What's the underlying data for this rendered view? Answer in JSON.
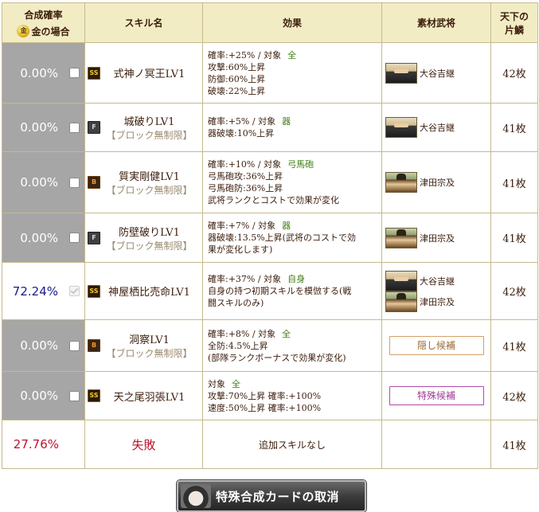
{
  "header": {
    "rate_title": "合成確率",
    "rate_sub": "金の場合",
    "coin_icon_text": "金",
    "skill": "スキル名",
    "effect": "効果",
    "material": "素材武将",
    "shard_line1": "天下の",
    "shard_line2": "片鱗"
  },
  "rows": [
    {
      "rate": "0.00%",
      "enabled": false,
      "checked": false,
      "rank": "SS",
      "name": "式神ノ冥王LV1",
      "sub": "",
      "effect_l1": "確率:+25% / 対象",
      "target": "全",
      "effect_rest": [
        "攻撃:60%上昇",
        "防御:60%上昇",
        "破壊:22%上昇"
      ],
      "materials": [
        {
          "name": "大谷吉継"
        }
      ],
      "tag": "",
      "count": "42枚"
    },
    {
      "rate": "0.00%",
      "enabled": false,
      "checked": false,
      "rank": "F",
      "name": "城破りLV1",
      "sub": "【ブロック無制限】",
      "effect_l1": "確率:+5% / 対象",
      "target": "器",
      "effect_rest": [
        "器破壊:10%上昇"
      ],
      "materials": [
        {
          "name": "大谷吉継"
        }
      ],
      "tag": "",
      "count": "41枚"
    },
    {
      "rate": "0.00%",
      "enabled": false,
      "checked": false,
      "rank": "B",
      "name": "質実剛健LV1",
      "sub": "【ブロック無制限】",
      "effect_l1": "確率:+10% / 対象",
      "target": "弓馬砲",
      "effect_rest": [
        "弓馬砲攻:36%上昇",
        "弓馬砲防:36%上昇",
        "武将ランクとコストで効果が変化"
      ],
      "materials": [
        {
          "name": "津田宗及"
        }
      ],
      "tag": "",
      "count": "41枚"
    },
    {
      "rate": "0.00%",
      "enabled": false,
      "checked": false,
      "rank": "F",
      "name": "防壁破りLV1",
      "sub": "【ブロック無制限】",
      "effect_l1": "確率:+7% / 対象",
      "target": "器",
      "effect_rest": [
        "器破壊:13.5%上昇(武将のコストで効",
        "果が変化します)"
      ],
      "materials": [
        {
          "name": "津田宗及"
        }
      ],
      "tag": "",
      "count": "41枚"
    },
    {
      "rate": "72.24%",
      "enabled": true,
      "checked": true,
      "rank": "SS",
      "name": "神屋栖比売命LV1",
      "sub": "",
      "effect_l1": "確率:+37% / 対象",
      "target": "自身",
      "effect_rest": [
        "自身の持つ初期スキルを模倣する(戦",
        "闘スキルのみ)"
      ],
      "materials": [
        {
          "name": "大谷吉継"
        },
        {
          "name": "津田宗及"
        }
      ],
      "tag": "",
      "count": "42枚"
    },
    {
      "rate": "0.00%",
      "enabled": false,
      "checked": false,
      "rank": "B",
      "name": "洞察LV1",
      "sub": "【ブロック無制限】",
      "effect_l1": "確率:+8% / 対象",
      "target": "全",
      "effect_rest": [
        "全防:4.5%上昇",
        "(部隊ランクボーナスで効果が変化)"
      ],
      "materials": [],
      "tag": "隠し候補",
      "tag_kind": "hid",
      "count": "41枚"
    },
    {
      "rate": "0.00%",
      "enabled": false,
      "checked": false,
      "rank": "SS",
      "name": "天之尾羽張LV1",
      "sub": "",
      "effect_l1": "対象",
      "target": "全",
      "effect_rest": [
        "攻撃:70%上昇  確率:+100%",
        "速度:50%上昇  確率:+100%"
      ],
      "materials": [],
      "tag": "特殊候補",
      "tag_kind": "spe",
      "count": "42枚"
    }
  ],
  "fail_row": {
    "rate": "27.76%",
    "label": "失敗",
    "effect": "追加スキルなし",
    "count": "41枚"
  },
  "footer": {
    "cancel_label": "特殊合成カードの取消"
  }
}
